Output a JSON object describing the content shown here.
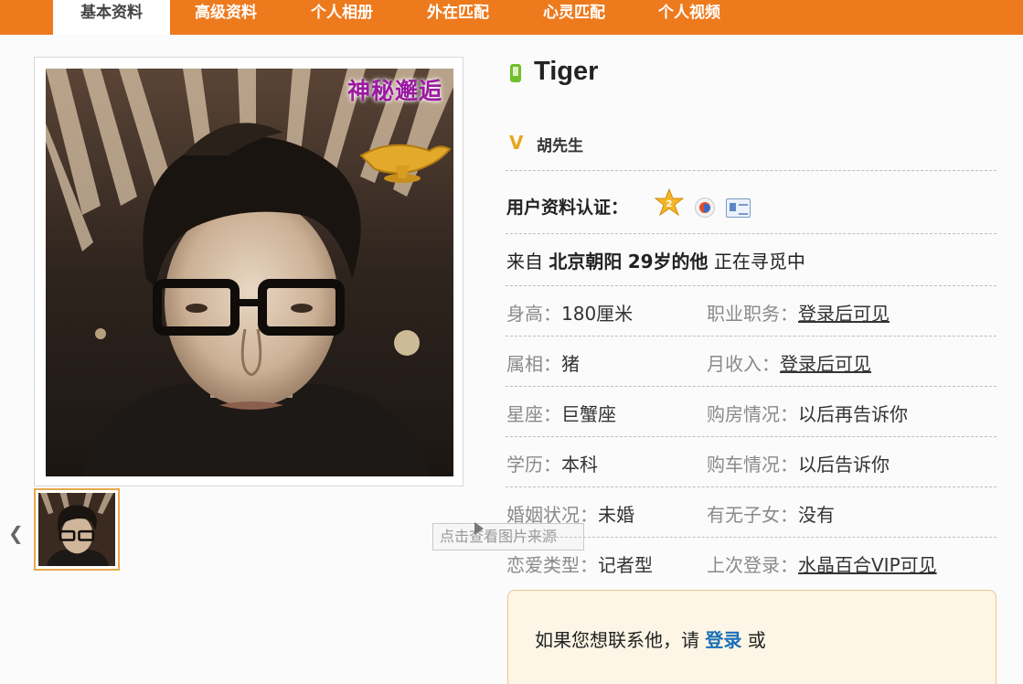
{
  "nav": {
    "tabs": [
      {
        "label": "基本资料",
        "active": true
      },
      {
        "label": "高级资料"
      },
      {
        "label": "个人相册"
      },
      {
        "label": "外在匹配"
      },
      {
        "label": "心灵匹配"
      },
      {
        "label": "个人视频"
      }
    ]
  },
  "photo": {
    "badge_text": "神秘邂逅",
    "tooltip": "点击查看图片来源"
  },
  "profile": {
    "username": "Tiger",
    "realname": "胡先生",
    "verify_label": "用户资料认证：",
    "from_prefix": "来自",
    "location": "北京朝阳",
    "age": "29岁的他",
    "status": "正在寻觅中"
  },
  "attributes": [
    {
      "label": "身高：",
      "value": "180厘米"
    },
    {
      "label": "职业职务：",
      "value": "登录后可见",
      "link": true
    },
    {
      "label": "属相：",
      "value": "猪"
    },
    {
      "label": "月收入：",
      "value": "登录后可见",
      "link": true
    },
    {
      "label": "星座：",
      "value": "巨蟹座"
    },
    {
      "label": "购房情况：",
      "value": "以后再告诉你"
    },
    {
      "label": "学历：",
      "value": "本科"
    },
    {
      "label": "购车情况：",
      "value": "以后告诉你"
    },
    {
      "label": "婚姻状况：",
      "value": "未婚"
    },
    {
      "label": "有无子女：",
      "value": "没有"
    },
    {
      "label": "恋爱类型：",
      "value": "记者型"
    },
    {
      "label": "上次登录：",
      "value": "水晶百合VIP可见",
      "link": true
    }
  ],
  "contact": {
    "prefix": "如果您想联系他，请",
    "login_link": "登录",
    "suffix": "或"
  },
  "colors": {
    "nav_bg": "#ee7a1e",
    "link": "#1a6fb8",
    "phone_icon": "#6fbf2b",
    "v_icon": "#e9a520"
  }
}
